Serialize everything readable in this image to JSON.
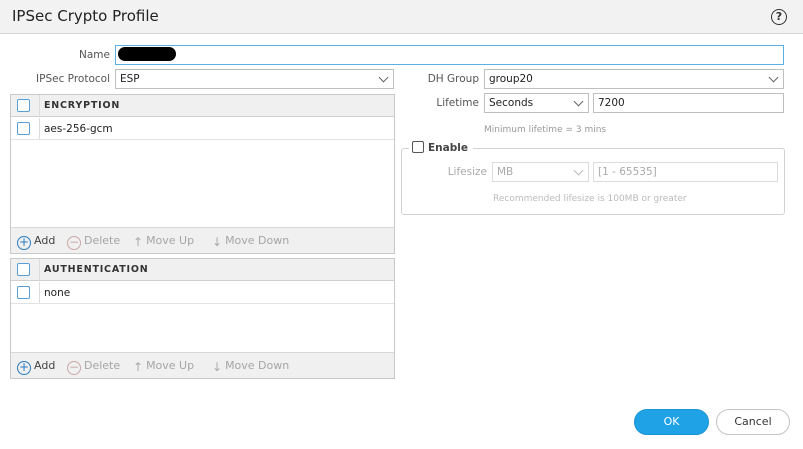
{
  "window": {
    "title": "IPSec Crypto Profile"
  },
  "form": {
    "name_label": "Name",
    "name_value": "",
    "ipsec_protocol_label": "IPSec Protocol",
    "ipsec_protocol_value": "ESP",
    "dh_group_label": "DH Group",
    "dh_group_value": "group20",
    "lifetime_label": "Lifetime",
    "lifetime_unit": "Seconds",
    "lifetime_value": "7200",
    "lifetime_hint": "Minimum lifetime = 3 mins"
  },
  "lifesize": {
    "enable_label": "Enable",
    "lifesize_label": "Lifesize",
    "unit_value": "MB",
    "value_placeholder": "[1 - 65535]",
    "hint": "Recommended lifesize is 100MB or greater"
  },
  "encryption": {
    "header": "ENCRYPTION",
    "rows": [
      "aes-256-gcm"
    ]
  },
  "authentication": {
    "header": "AUTHENTICATION",
    "rows": [
      "none"
    ]
  },
  "toolbar": {
    "add": "Add",
    "delete": "Delete",
    "move_up": "Move Up",
    "move_down": "Move Down"
  },
  "buttons": {
    "ok": "OK",
    "cancel": "Cancel"
  },
  "icons": {
    "help": "help-icon",
    "add": "plus-circle-icon",
    "delete": "minus-circle-icon",
    "up": "arrow-up-icon",
    "down": "arrow-down-icon"
  },
  "colors": {
    "primary": "#1fa3e6",
    "focus": "#5ab0e6",
    "checkbox": "#5a9ed6"
  }
}
